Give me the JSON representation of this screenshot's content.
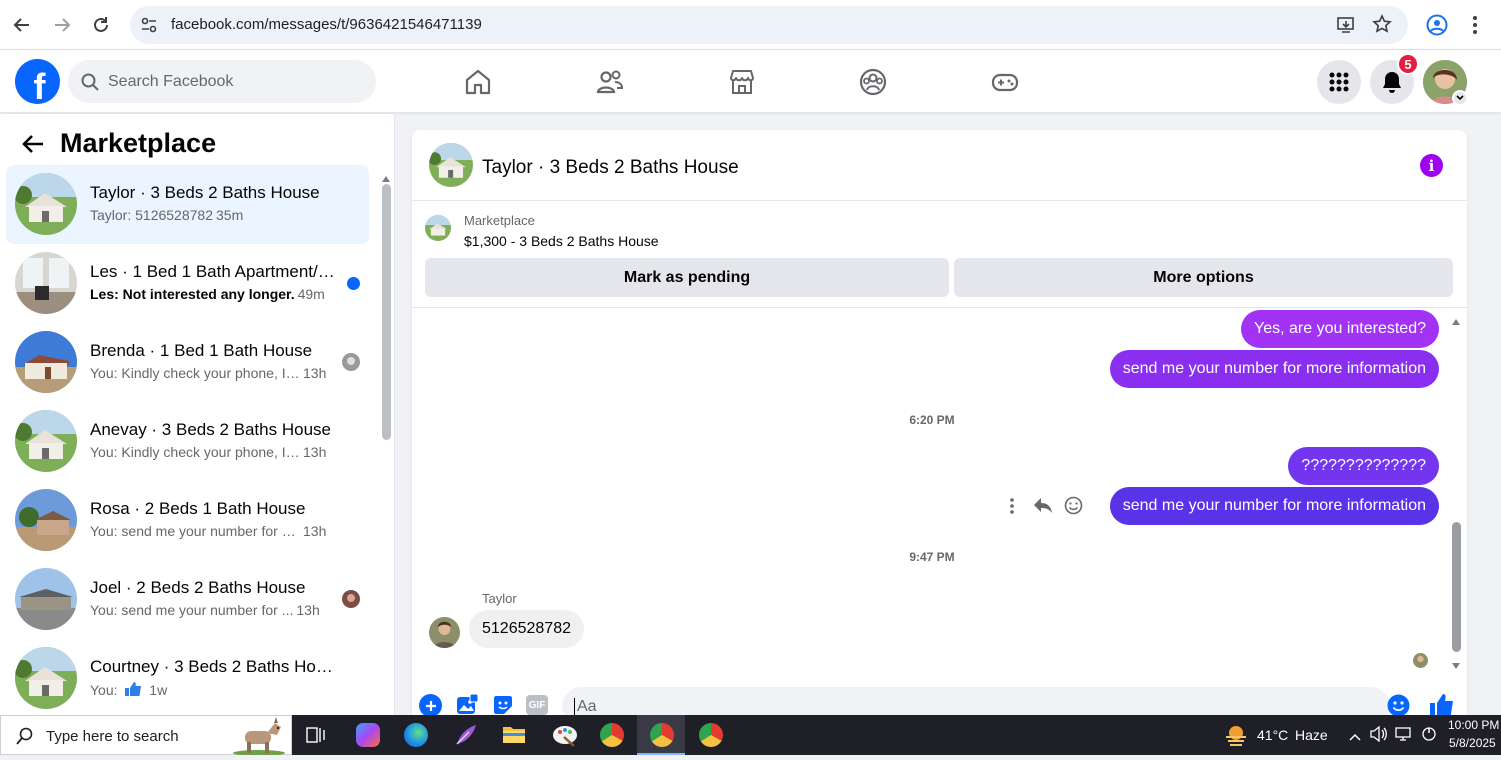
{
  "browser": {
    "url": "facebook.com/messages/t/9636421546471139"
  },
  "header": {
    "logo": "f",
    "search_placeholder": "Search Facebook",
    "notifications_count": "5"
  },
  "left": {
    "title": "Marketplace",
    "conversations": [
      {
        "title": "Taylor · 3 Beds 2 Baths House",
        "preview": "Taylor: 5126528782",
        "time": "35m",
        "unread": false
      },
      {
        "title": "Les · 1 Bed 1 Bath Apartment/c...",
        "preview": "Les: Not interested any longer.",
        "time": "49m",
        "unread": true
      },
      {
        "title": "Brenda · 1 Bed 1 Bath House",
        "preview": "You: Kindly check your phone, I ...",
        "time": "13h",
        "unread": false
      },
      {
        "title": "Anevay · 3 Beds 2 Baths House",
        "preview": "You: Kindly check your phone, I wil...",
        "time": "13h",
        "unread": false
      },
      {
        "title": "Rosa · 2 Beds 1 Bath House",
        "preview": "You: send me your number for mo...",
        "time": "13h",
        "unread": false
      },
      {
        "title": "Joel · 2 Beds 2 Baths House",
        "preview": "You: send me your number for ...",
        "time": "13h",
        "unread": false
      },
      {
        "title": "Courtney · 3 Beds 2 Baths House",
        "preview": "You:",
        "time": "1w",
        "unread": false
      }
    ]
  },
  "chat": {
    "title": "Taylor · 3 Beds 2 Baths House",
    "listing_source": "Marketplace",
    "listing_title": "$1,300 - 3 Beds 2 Baths House",
    "mark_pending_label": "Mark as pending",
    "more_options_label": "More options",
    "messages": {
      "m1": "Yes, are you interested?",
      "m2": "send me your number for more information",
      "t1": "6:20 PM",
      "m3": "??????????????",
      "m4": "send me your number for more information",
      "t2": "9:47 PM",
      "sender": "Taylor",
      "in1": "5126528782"
    },
    "composer_placeholder": "Aa",
    "gif_label": "GIF"
  },
  "taskbar": {
    "search_placeholder": "Type here to search",
    "weather": "41°C",
    "weather_desc": "Haze",
    "time": "10:00 PM",
    "date": "5/8/2025"
  },
  "colors": {
    "fb_blue": "#0866ff",
    "bubble_purple": "#a033ff",
    "bubble_indigo": "#5b2ee6",
    "active_row": "#ebf5ff"
  }
}
